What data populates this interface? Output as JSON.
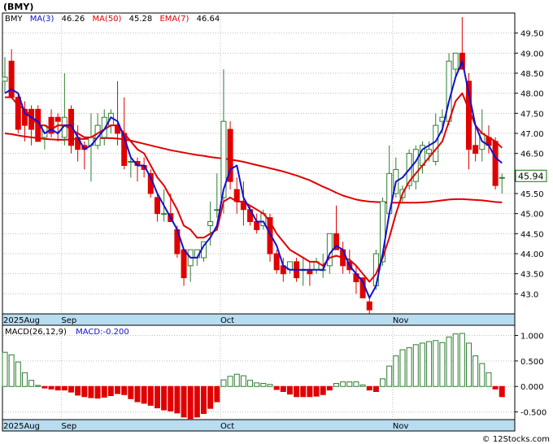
{
  "ticker": "(BMY)",
  "copyright": "© 12Stocks.com",
  "colors": {
    "up": "#2e7d32",
    "down": "#e00000",
    "ma3": "#1010d0",
    "ma50": "#e00000",
    "ema7": "#e00000",
    "band": "#b8dcf0",
    "price_box": "#0a7a0a"
  },
  "legend": {
    "symbol": "BMY",
    "ma3_label": "MA(3)",
    "ma3_value": "46.26",
    "ma50_label": "MA(50)",
    "ma50_value": "45.28",
    "ema7_label": "EMA(7)",
    "ema7_value": "46.64"
  },
  "last_price": "45.94",
  "macd_legend": {
    "label": "MACD(26,12,9)",
    "value": "MACD:-0.200"
  },
  "month_labels": [
    "2025Aug",
    "Sep",
    "Oct",
    "Nov"
  ],
  "chart_data": [
    {
      "type": "candlestick",
      "title": "(BMY)",
      "ylim": [
        42.5,
        50.0
      ],
      "yticks": [
        43.0,
        43.5,
        44.0,
        44.5,
        45.0,
        45.5,
        46.0,
        46.5,
        47.0,
        47.5,
        48.0,
        48.5,
        49.0,
        49.5
      ],
      "ytick_labels": [
        "43.0",
        "43.50",
        "44.00",
        "44.50",
        "45.00",
        "45.50",
        "46.00",
        "46.50",
        "47.00",
        "47.50",
        "48.00",
        "48.50",
        "49.00",
        "49.50"
      ],
      "grid": true,
      "ohlc": [
        [
          48.3,
          48.9,
          48.0,
          48.4
        ],
        [
          48.8,
          49.1,
          47.9,
          47.9
        ],
        [
          47.9,
          48.0,
          47.0,
          47.1
        ],
        [
          47.6,
          47.8,
          46.8,
          47.2
        ],
        [
          47.6,
          47.7,
          46.7,
          47.1
        ],
        [
          47.6,
          47.7,
          46.8,
          46.8
        ],
        [
          46.9,
          47.2,
          46.6,
          47.2
        ],
        [
          47.4,
          47.6,
          46.9,
          47.0
        ],
        [
          47.4,
          47.5,
          46.8,
          47.3
        ],
        [
          46.9,
          48.5,
          46.7,
          47.4
        ],
        [
          47.6,
          47.7,
          46.5,
          46.7
        ],
        [
          46.9,
          47.2,
          46.3,
          46.6
        ],
        [
          46.7,
          46.8,
          46.1,
          46.6
        ],
        [
          46.7,
          47.5,
          45.8,
          46.9
        ],
        [
          46.7,
          47.5,
          46.6,
          47.2
        ],
        [
          46.9,
          47.6,
          46.7,
          47.4
        ],
        [
          47.2,
          47.6,
          47.0,
          47.5
        ],
        [
          47.2,
          48.3,
          46.7,
          47.0
        ],
        [
          47.0,
          47.9,
          46.1,
          46.2
        ],
        [
          46.3,
          46.4,
          45.9,
          46.3
        ],
        [
          46.3,
          46.4,
          45.8,
          46.2
        ],
        [
          46.2,
          46.4,
          45.9,
          46.1
        ],
        [
          46.0,
          46.1,
          45.4,
          45.5
        ],
        [
          45.4,
          45.5,
          44.8,
          45.0
        ],
        [
          45.0,
          45.6,
          44.8,
          45.0
        ],
        [
          45.0,
          45.5,
          44.8,
          44.8
        ],
        [
          44.6,
          44.7,
          43.9,
          44.0
        ],
        [
          44.1,
          44.1,
          43.2,
          43.4
        ],
        [
          43.7,
          44.1,
          43.3,
          44.1
        ],
        [
          43.9,
          44.1,
          43.7,
          44.1
        ],
        [
          43.9,
          44.3,
          43.8,
          44.3
        ],
        [
          44.7,
          45.3,
          44.2,
          44.8
        ],
        [
          45.1,
          46.0,
          44.9,
          45.1
        ],
        [
          45.4,
          48.6,
          45.0,
          47.3
        ],
        [
          47.1,
          47.3,
          45.6,
          45.8
        ],
        [
          45.6,
          45.9,
          45.0,
          45.3
        ],
        [
          45.3,
          45.8,
          44.7,
          45.1
        ],
        [
          45.1,
          45.2,
          44.7,
          44.8
        ],
        [
          44.8,
          45.0,
          44.5,
          44.6
        ],
        [
          44.7,
          45.1,
          44.6,
          45.0
        ],
        [
          44.9,
          45.0,
          43.8,
          44.0
        ],
        [
          44.0,
          44.1,
          43.5,
          43.6
        ],
        [
          43.7,
          43.9,
          43.3,
          43.5
        ],
        [
          43.6,
          43.8,
          43.5,
          43.8
        ],
        [
          43.8,
          43.9,
          43.3,
          43.4
        ],
        [
          43.6,
          43.9,
          43.2,
          43.6
        ],
        [
          43.6,
          43.8,
          43.2,
          43.5
        ],
        [
          43.6,
          43.9,
          43.5,
          43.8
        ],
        [
          43.6,
          44.0,
          43.4,
          43.6
        ],
        [
          43.7,
          44.5,
          43.5,
          44.5
        ],
        [
          44.5,
          45.2,
          44.2,
          44.1
        ],
        [
          44.1,
          44.3,
          43.5,
          43.7
        ],
        [
          43.8,
          44.1,
          43.5,
          43.6
        ],
        [
          43.5,
          43.7,
          43.0,
          43.3
        ],
        [
          43.4,
          43.4,
          42.9,
          42.9
        ],
        [
          42.8,
          42.9,
          42.5,
          42.6
        ],
        [
          43.2,
          44.1,
          43.1,
          44.0
        ],
        [
          43.8,
          45.4,
          43.7,
          45.3
        ],
        [
          45.0,
          46.7,
          44.9,
          46.0
        ],
        [
          45.5,
          46.4,
          45.4,
          46.1
        ],
        [
          45.4,
          45.7,
          45.3,
          45.6
        ],
        [
          45.7,
          46.6,
          45.6,
          46.5
        ],
        [
          45.8,
          46.7,
          45.6,
          46.6
        ],
        [
          46.2,
          46.8,
          46.0,
          46.7
        ],
        [
          46.5,
          46.8,
          46.3,
          46.6
        ],
        [
          46.3,
          47.5,
          46.2,
          47.2
        ],
        [
          47.3,
          47.6,
          47.0,
          47.4
        ],
        [
          47.3,
          49.0,
          47.2,
          48.8
        ],
        [
          48.6,
          49.0,
          48.4,
          49.0
        ],
        [
          49.0,
          49.9,
          48.8,
          48.6
        ],
        [
          48.3,
          48.5,
          46.1,
          46.6
        ],
        [
          46.7,
          47.2,
          46.3,
          46.5
        ],
        [
          46.6,
          47.6,
          46.3,
          47.0
        ],
        [
          46.9,
          47.2,
          46.5,
          46.7
        ],
        [
          46.8,
          46.9,
          45.6,
          45.7
        ],
        [
          45.9,
          46.0,
          45.5,
          45.9
        ]
      ],
      "series": [
        {
          "name": "MA(3)",
          "values": [
            48.0,
            48.1,
            48.0,
            47.5,
            47.4,
            47.3,
            47.0,
            47.1,
            47.0,
            47.2,
            47.2,
            46.9,
            46.6,
            46.7,
            46.9,
            47.1,
            47.4,
            47.3,
            46.9,
            46.4,
            46.2,
            46.2,
            45.9,
            45.5,
            45.2,
            44.9,
            44.6,
            44.1,
            43.9,
            43.9,
            44.2,
            44.4,
            44.7,
            45.6,
            46.1,
            46.2,
            45.4,
            45.1,
            44.8,
            44.8,
            44.5,
            44.2,
            43.7,
            43.6,
            43.6,
            43.6,
            43.6,
            43.6,
            43.6,
            44.0,
            44.2,
            44.1,
            43.7,
            43.5,
            43.3,
            42.9,
            43.2,
            44.0,
            45.0,
            45.8,
            45.9,
            46.1,
            46.3,
            46.6,
            46.7,
            46.8,
            47.1,
            47.8,
            48.4,
            48.8,
            48.0,
            47.2,
            46.8,
            46.7,
            46.4,
            46.26
          ]
        },
        {
          "name": "MA(50)",
          "values": [
            47.0,
            46.98,
            46.95,
            46.92,
            46.9,
            46.88,
            46.86,
            46.85,
            46.84,
            46.84,
            46.85,
            46.86,
            46.86,
            46.87,
            46.88,
            46.88,
            46.88,
            46.87,
            46.85,
            46.82,
            46.78,
            46.74,
            46.7,
            46.66,
            46.62,
            46.58,
            46.55,
            46.52,
            46.49,
            46.46,
            46.44,
            46.41,
            46.39,
            46.37,
            46.35,
            46.32,
            46.29,
            46.25,
            46.21,
            46.17,
            46.13,
            46.09,
            46.05,
            46.0,
            45.95,
            45.89,
            45.83,
            45.75,
            45.67,
            45.6,
            45.52,
            45.45,
            45.4,
            45.35,
            45.32,
            45.3,
            45.29,
            45.28,
            45.27,
            45.27,
            45.27,
            45.27,
            45.27,
            45.28,
            45.29,
            45.31,
            45.33,
            45.35,
            45.36,
            45.36,
            45.35,
            45.34,
            45.33,
            45.31,
            45.29,
            45.28
          ]
        },
        {
          "name": "EMA(7)",
          "values": [
            47.9,
            47.9,
            47.7,
            47.6,
            47.4,
            47.2,
            47.2,
            47.1,
            47.2,
            47.2,
            47.1,
            47.0,
            46.9,
            46.9,
            47.0,
            47.1,
            47.2,
            47.2,
            47.0,
            46.8,
            46.6,
            46.5,
            46.2,
            45.9,
            45.7,
            45.4,
            45.1,
            44.7,
            44.6,
            44.4,
            44.4,
            44.5,
            44.6,
            45.3,
            45.4,
            45.3,
            45.3,
            45.2,
            45.1,
            45.0,
            44.8,
            44.5,
            44.3,
            44.1,
            44.0,
            43.9,
            43.8,
            43.8,
            43.7,
            43.9,
            43.95,
            43.9,
            43.85,
            43.7,
            43.5,
            43.3,
            43.5,
            43.9,
            44.4,
            45.0,
            45.5,
            45.8,
            46.0,
            46.2,
            46.4,
            46.6,
            46.8,
            47.3,
            47.8,
            48.0,
            47.6,
            47.2,
            47.0,
            46.9,
            46.8,
            46.64
          ]
        }
      ]
    },
    {
      "type": "bar",
      "title": "MACD(26,12,9)",
      "ylim": [
        -0.65,
        1.2
      ],
      "yticks": [
        1.0,
        0.5,
        0.0,
        -0.5
      ],
      "ytick_labels": [
        "1.000",
        "0.500",
        "0.000",
        "-0.500"
      ],
      "grid": true,
      "values": [
        0.67,
        0.62,
        0.48,
        0.27,
        0.12,
        0.02,
        -0.03,
        -0.05,
        -0.07,
        -0.07,
        -0.11,
        -0.17,
        -0.2,
        -0.22,
        -0.23,
        -0.21,
        -0.18,
        -0.14,
        -0.16,
        -0.24,
        -0.3,
        -0.33,
        -0.37,
        -0.42,
        -0.46,
        -0.48,
        -0.52,
        -0.6,
        -0.63,
        -0.6,
        -0.53,
        -0.43,
        -0.3,
        0.13,
        0.2,
        0.24,
        0.21,
        0.12,
        0.07,
        0.06,
        0.04,
        -0.06,
        -0.1,
        -0.15,
        -0.2,
        -0.2,
        -0.2,
        -0.19,
        -0.16,
        -0.07,
        0.06,
        0.09,
        0.09,
        0.09,
        0.03,
        -0.07,
        -0.1,
        0.15,
        0.4,
        0.6,
        0.72,
        0.76,
        0.82,
        0.85,
        0.88,
        0.9,
        0.86,
        0.97,
        1.03,
        1.04,
        0.85,
        0.6,
        0.45,
        0.27,
        -0.05,
        -0.2
      ]
    }
  ]
}
